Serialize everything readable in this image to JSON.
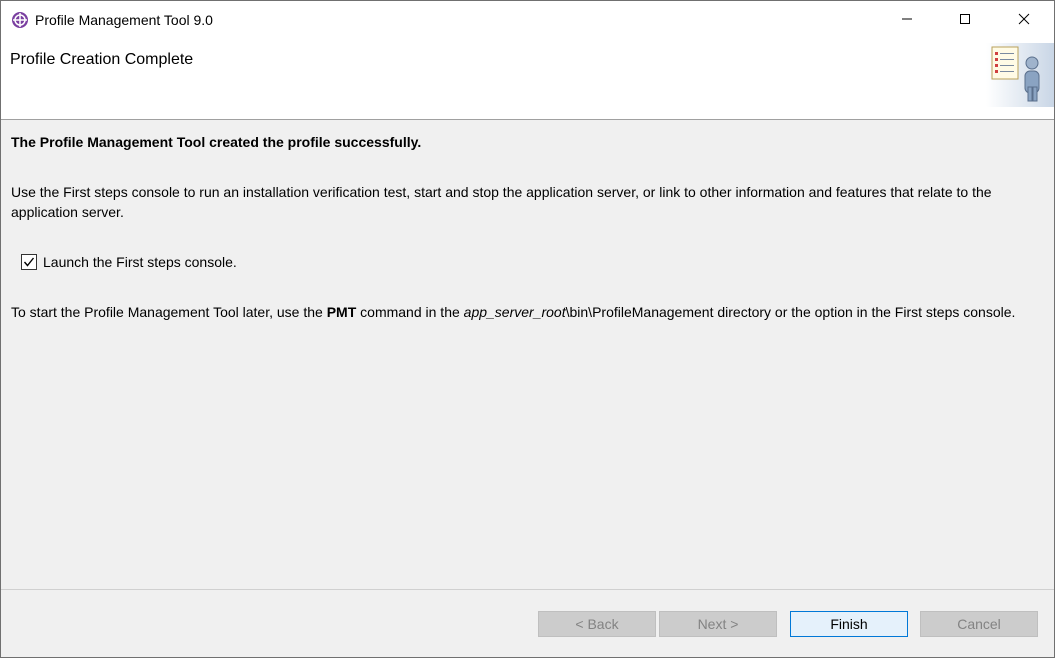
{
  "window": {
    "title": "Profile Management Tool 9.0"
  },
  "banner": {
    "title": "Profile Creation Complete"
  },
  "content": {
    "headline": "The Profile Management Tool created the profile successfully.",
    "description": "Use the First steps console to run an installation verification test, start and stop the application server, or link to other information and features that relate to the application server.",
    "checkbox_label": "Launch the First steps console.",
    "checkbox_checked": true,
    "hint_part1": "To start the Profile Management Tool later, use the ",
    "hint_command": "PMT",
    "hint_part2": " command in the ",
    "hint_path_var": "app_server_root",
    "hint_part3": "\\bin\\ProfileManagement directory or the option in the First steps console."
  },
  "buttons": {
    "back": "< Back",
    "next": "Next >",
    "finish": "Finish",
    "cancel": "Cancel"
  },
  "icons": {
    "app": "app-icon",
    "minimize": "minimize-icon",
    "maximize": "maximize-icon",
    "close": "close-icon",
    "banner": "profile-wizard-icon",
    "check": "checkmark-icon"
  }
}
